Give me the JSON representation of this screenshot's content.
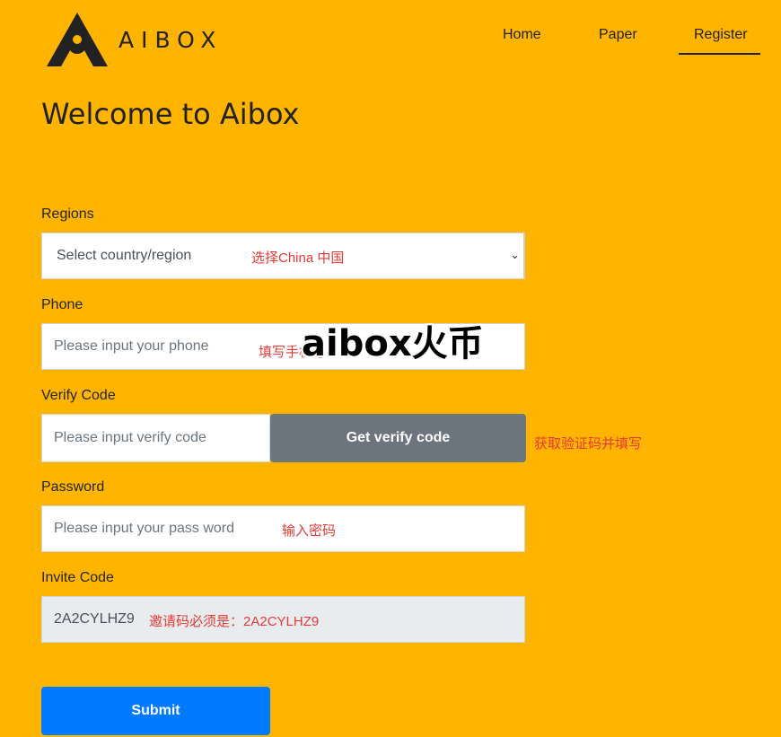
{
  "brand": {
    "name": "AIBOX"
  },
  "nav": {
    "home": "Home",
    "paper": "Paper",
    "register": "Register",
    "active": "Register"
  },
  "page": {
    "title": "Welcome to Aibox"
  },
  "form": {
    "regions": {
      "label": "Regions",
      "value": "Select country/region",
      "hint": "选择China 中国"
    },
    "phone": {
      "label": "Phone",
      "placeholder": "Please input your phone",
      "hint": "填写手机号"
    },
    "verify": {
      "label": "Verify Code",
      "placeholder": "Please input verify code",
      "button": "Get verify code",
      "hint": "获取验证码并填写"
    },
    "password": {
      "label": "Password",
      "placeholder": "Please input your pass word",
      "hint": "输入密码"
    },
    "invite": {
      "label": "Invite Code",
      "value": "2A2CYLHZ9",
      "hint": "邀请码必须是：2A2CYLHZ9"
    },
    "submit": "Submit"
  },
  "overlay": {
    "watermark": "aibox火币"
  },
  "colors": {
    "background": "#ffb400",
    "primary": "#007bff",
    "secondary": "#6c757d",
    "hint": "#e53935"
  }
}
